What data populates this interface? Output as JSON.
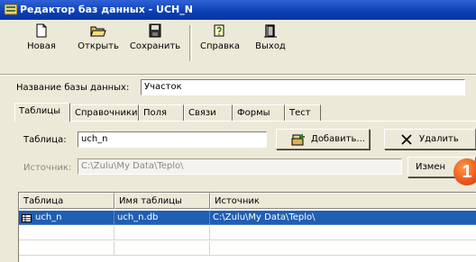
{
  "window": {
    "title": "Редактор баз данных - UCH_N"
  },
  "toolbar": {
    "new_label": "Новая",
    "open_label": "Открыть",
    "save_label": "Сохранить",
    "help_label": "Справка",
    "exit_label": "Выход"
  },
  "db_name": {
    "label": "Название базы данных:",
    "value": "Участок"
  },
  "tabs": [
    {
      "label": "Таблицы"
    },
    {
      "label": "Справочники"
    },
    {
      "label": "Поля"
    },
    {
      "label": "Связи"
    },
    {
      "label": "Формы"
    },
    {
      "label": "Тест"
    }
  ],
  "table_field": {
    "label": "Таблица:",
    "value": "uch_n"
  },
  "buttons": {
    "add": "Добавить...",
    "delete": "Удалить",
    "change": "Измен"
  },
  "source_field": {
    "label": "Источник:",
    "value": "C:\\Zulu\\My Data\\Teplo\\"
  },
  "grid": {
    "columns": [
      "Таблица",
      "Имя таблицы",
      "Источник"
    ],
    "rows": [
      {
        "table": "uch_n",
        "file": "uch_n.db",
        "source": "C:\\Zulu\\My Data\\Teplo\\"
      }
    ]
  },
  "callout": {
    "number": "1"
  },
  "icons": [
    "app-icon",
    "new-document-icon",
    "open-folder-icon",
    "save-disk-icon",
    "help-icon",
    "exit-door-icon",
    "add-icon",
    "delete-x-icon",
    "table-icon"
  ]
}
